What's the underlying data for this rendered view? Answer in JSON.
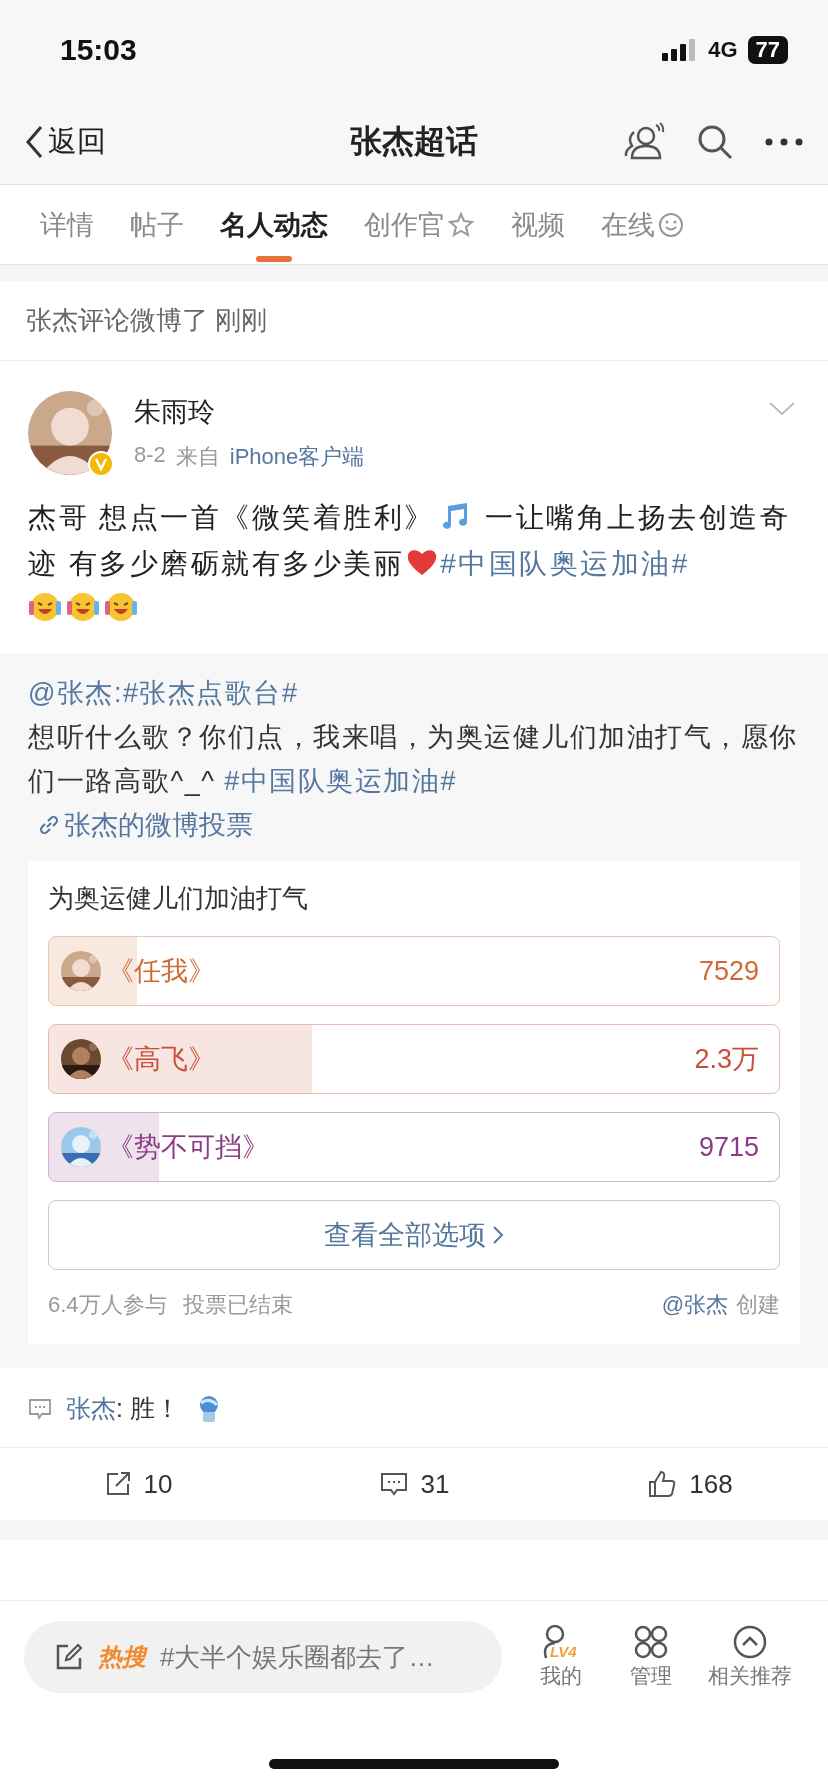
{
  "status_bar": {
    "time": "15:03",
    "network": "4G",
    "battery": "77"
  },
  "nav": {
    "back": "返回",
    "title": "张杰超话"
  },
  "tabs": [
    {
      "label": "详情",
      "selected": false,
      "kind": "plain"
    },
    {
      "label": "帖子",
      "selected": false,
      "kind": "plain"
    },
    {
      "label": "名人动态",
      "selected": true,
      "kind": "plain"
    },
    {
      "label": "创作官",
      "selected": false,
      "kind": "star"
    },
    {
      "label": "视频",
      "selected": false,
      "kind": "plain"
    },
    {
      "label": "在线",
      "selected": false,
      "kind": "face"
    }
  ],
  "feed_header": "张杰评论微博了 刚刚",
  "post": {
    "author": "朱雨玲",
    "verified": true,
    "date": "8-2",
    "source_prefix": "来自",
    "source": "iPhone客户端",
    "body": [
      {
        "kind": "text",
        "text": "杰哥 想点一首《微笑着胜利》"
      },
      {
        "kind": "music"
      },
      {
        "kind": "text",
        "text": " 一让嘴角上扬去创造奇迹 有多少磨砺就有多少美丽"
      },
      {
        "kind": "heart"
      },
      {
        "kind": "hashtag",
        "text": "#中国队奥运加油#"
      },
      {
        "kind": "break"
      },
      {
        "kind": "laugh"
      },
      {
        "kind": "laugh"
      },
      {
        "kind": "laugh"
      }
    ]
  },
  "retweet": {
    "head": {
      "mention": "@张杰",
      "separator": ":",
      "hashtag": "#张杰点歌台#"
    },
    "body": [
      {
        "kind": "text",
        "text": "想听什么歌？你们点，我来唱，为奥运健儿们加油打气，愿你们一路高歌^_^ "
      },
      {
        "kind": "hashtag",
        "text": "#中国队奥运加油#"
      }
    ],
    "link": "张杰的微博投票",
    "poll": {
      "title": "为奥运健儿们加油打气",
      "options": [
        {
          "label": "《任我》",
          "count": "7529",
          "level": 0.12,
          "color": "#d06a32"
        },
        {
          "label": "《高飞》",
          "count": "2.3万",
          "level": 0.36,
          "color": "#c8503a"
        },
        {
          "label": "《势不可挡》",
          "count": "9715",
          "level": 0.15,
          "color": "#8a3c86"
        }
      ],
      "view_all": "查看全部选项",
      "participants": "6.4万人参与",
      "status": "投票已结束",
      "creator": "@张杰",
      "creator_suffix": "创建"
    }
  },
  "comment": {
    "author": "张杰",
    "text": ": 胜！"
  },
  "actions": [
    {
      "kind": "share",
      "count": "10"
    },
    {
      "kind": "comment",
      "count": "31"
    },
    {
      "kind": "like",
      "count": "168"
    }
  ],
  "bottom_bar": {
    "hot_label": "热搜",
    "hot_text": "#大半个娱乐圈都去了…",
    "items": [
      {
        "kind": "profile",
        "label": "我的",
        "badge": "LV4"
      },
      {
        "kind": "manage",
        "label": "管理"
      },
      {
        "kind": "recommend",
        "label": "相关推荐"
      }
    ]
  }
}
